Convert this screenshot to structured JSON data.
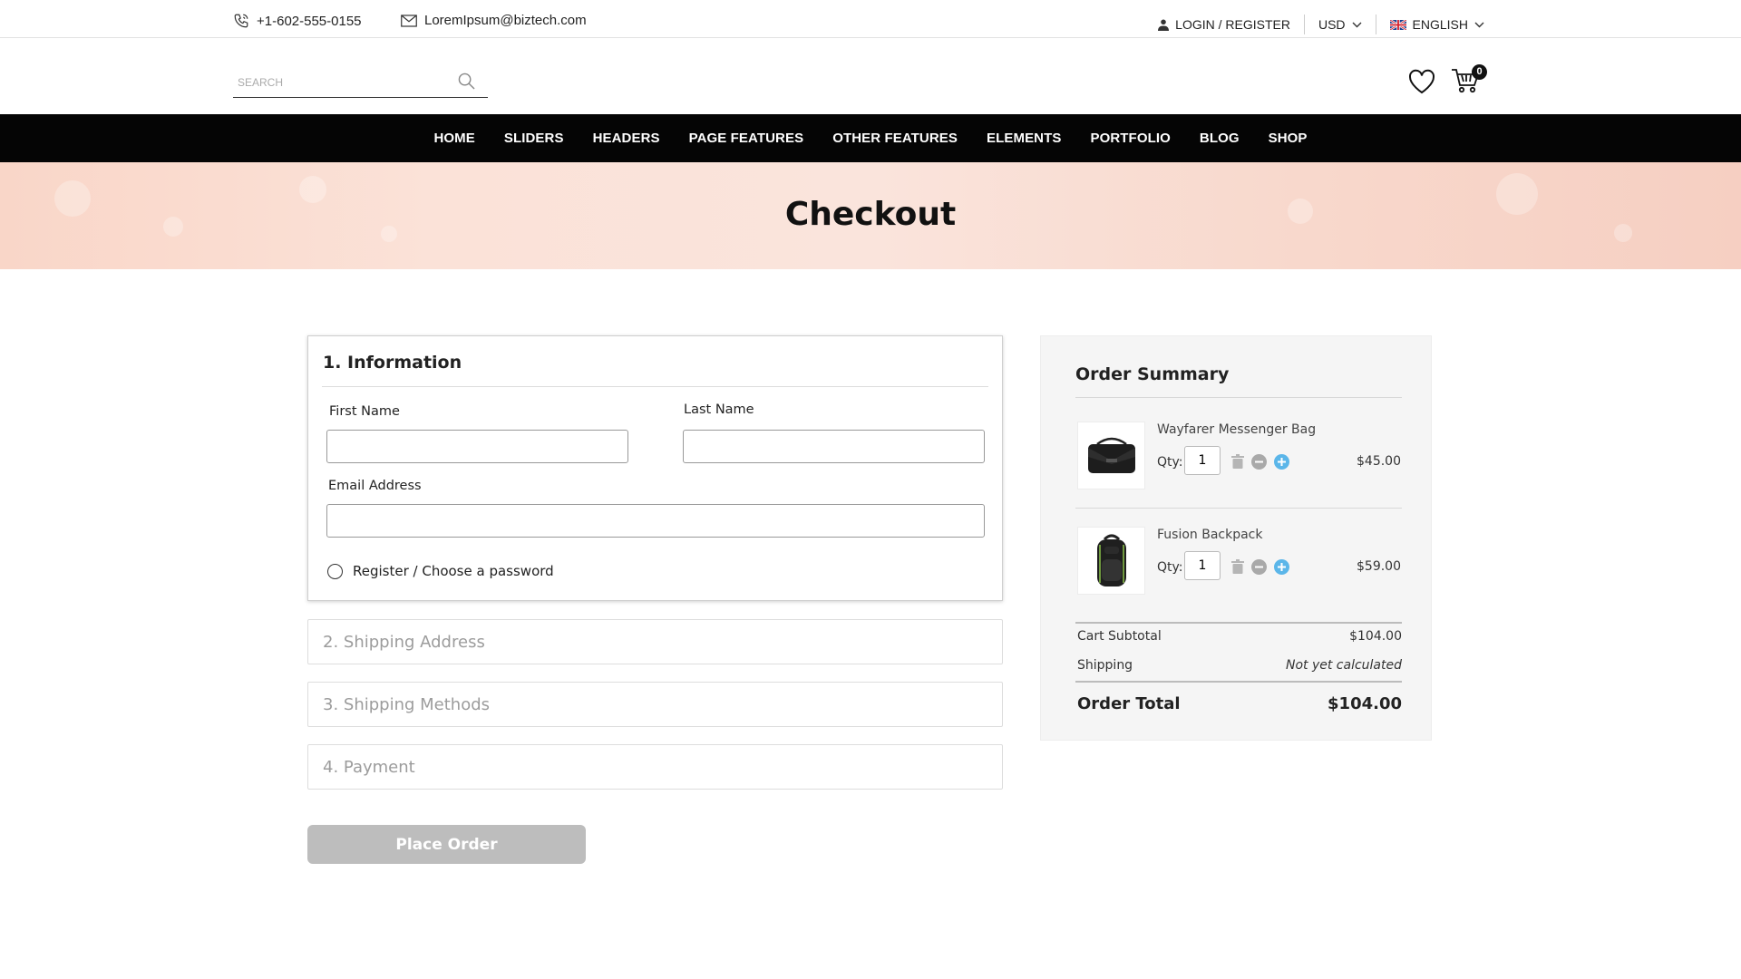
{
  "topbar": {
    "phone": "+1-602-555-0155",
    "email": "LoremIpsum@biztech.com",
    "login": "LOGIN / REGISTER",
    "currency": "USD",
    "language": "ENGLISH"
  },
  "header": {
    "search_placeholder": "SEARCH",
    "cart_count": "0"
  },
  "nav": {
    "items": [
      "HOME",
      "SLIDERS",
      "HEADERS",
      "PAGE FEATURES",
      "OTHER FEATURES",
      "ELEMENTS",
      "PORTFOLIO",
      "BLOG",
      "SHOP"
    ]
  },
  "banner": {
    "title": "Checkout"
  },
  "info": {
    "title": "1. Information",
    "first_name_label": "First Name",
    "first_name_value": "",
    "last_name_label": "Last Name",
    "last_name_value": "",
    "email_label": "Email Address",
    "email_value": "",
    "register_label": "Register / Choose a password"
  },
  "steps": [
    "2. Shipping Address",
    "3. Shipping Methods",
    "4. Payment"
  ],
  "place_order": "Place Order",
  "summary": {
    "title": "Order Summary",
    "qty_label": "Qty:",
    "products": [
      {
        "name": "Wayfarer Messenger Bag",
        "qty": "1",
        "price": "$45.00",
        "image_icon": "messenger-bag-image"
      },
      {
        "name": "Fusion Backpack",
        "qty": "1",
        "price": "$59.00",
        "image_icon": "backpack-image"
      }
    ],
    "subtotal_label": "Cart Subtotal",
    "subtotal_value": "$104.00",
    "shipping_label": "Shipping",
    "shipping_value": "Not yet calculated",
    "total_label": "Order Total",
    "total_value": "$104.00"
  },
  "colors": {
    "nav_bg": "#050505",
    "banner_bg": "#f9d6c8",
    "place_order_bg": "#bdbdbd",
    "plus_icon": "#5bb6e9",
    "summary_bg": "#f5f5f5"
  }
}
